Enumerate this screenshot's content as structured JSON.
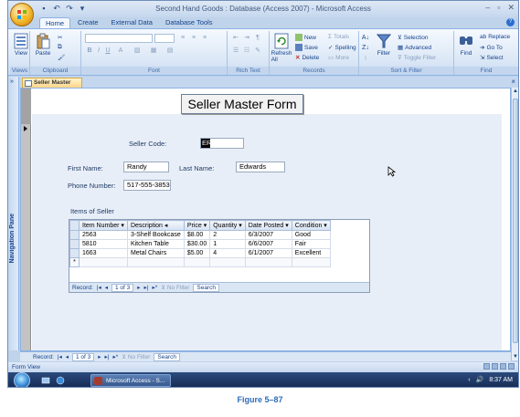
{
  "window": {
    "title": "Second Hand Goods : Database (Access 2007) - Microsoft Access",
    "controls": [
      "–",
      "▫",
      "✕"
    ]
  },
  "ribbon": {
    "tabs": [
      {
        "label": "Home",
        "active": true
      },
      {
        "label": "Create",
        "active": false
      },
      {
        "label": "External Data",
        "active": false
      },
      {
        "label": "Database Tools",
        "active": false
      }
    ],
    "groups": {
      "views": {
        "label": "Views",
        "view_button": "View"
      },
      "clipboard": {
        "label": "Clipboard",
        "paste_button": "Paste"
      },
      "font": {
        "label": "Font"
      },
      "rich_text": {
        "label": "Rich Text"
      },
      "records": {
        "label": "Records",
        "refresh_button": "Refresh All",
        "new": "New",
        "save": "Save",
        "delete": "Delete",
        "totals": "Totals",
        "spelling": "Spelling",
        "more": "More"
      },
      "sort_filter": {
        "label": "Sort & Filter",
        "filter_button": "Filter",
        "selection": "Selection",
        "advanced": "Advanced",
        "toggle_filter": "Toggle Filter"
      },
      "find": {
        "label": "Find",
        "find_button": "Find",
        "replace": "Replace",
        "goto": "Go To",
        "select": "Select"
      }
    }
  },
  "nav_pane": {
    "label": "Navigation Pane",
    "chevron": "»"
  },
  "document_tab": {
    "label": "Seller Master Form",
    "close": "×"
  },
  "form": {
    "title": "Seller Master Form",
    "seller_code_label": "Seller Code:",
    "seller_code_value": "ER",
    "first_name_label": "First Name:",
    "first_name_value": "Randy",
    "last_name_label": "Last Name:",
    "last_name_value": "Edwards",
    "phone_label": "Phone Number:",
    "phone_value": "517-555-3853",
    "items_label": "Items of Seller"
  },
  "subform": {
    "columns": [
      "Item Number",
      "Description",
      "Price",
      "Quantity",
      "Date Posted",
      "Condition"
    ],
    "rows": [
      [
        "2563",
        "3-Shelf Bookcase",
        "$8.00",
        "2",
        "6/3/2007",
        "Good"
      ],
      [
        "5810",
        "Kitchen Table",
        "$30.00",
        "1",
        "6/6/2007",
        "Fair"
      ],
      [
        "1663",
        "Metal Chairs",
        "$5.00",
        "4",
        "6/1/2007",
        "Excellent"
      ]
    ],
    "new_row_marker": "*",
    "nav": {
      "label": "Record:",
      "position": "1 of 3",
      "filter": "No Filter",
      "search": "Search"
    }
  },
  "main_nav": {
    "label": "Record:",
    "position": "1 of 3",
    "filter": "No Filter",
    "search": "Search"
  },
  "status": {
    "text": "Form View"
  },
  "taskbar": {
    "task_label": "Microsoft Access - S...",
    "clock": "8:37 AM"
  },
  "caption": "Figure 5–87"
}
